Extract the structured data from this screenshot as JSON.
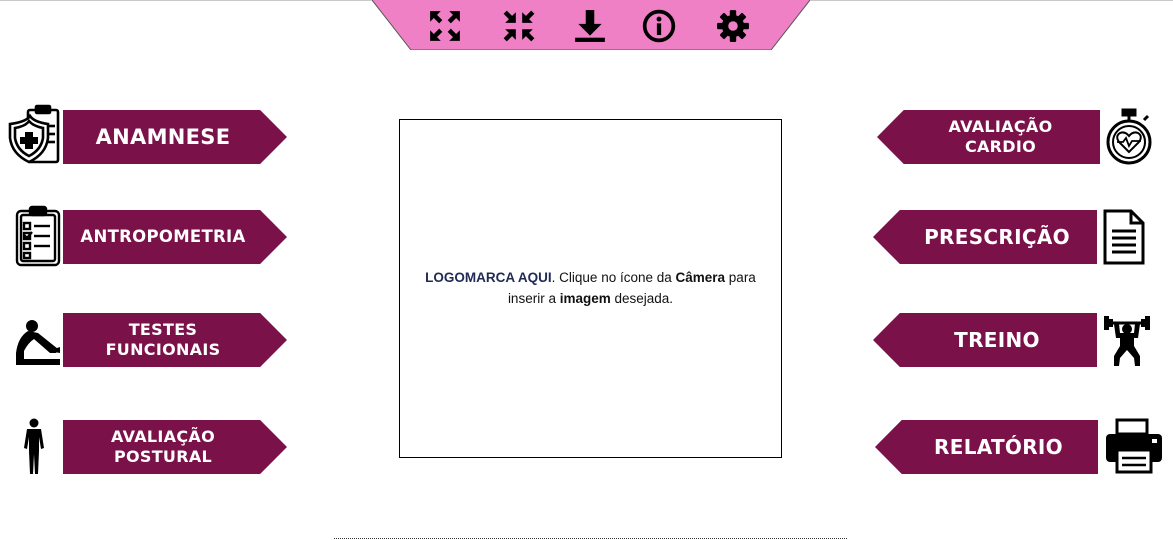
{
  "toolbar": {
    "color": "#ef80c6",
    "buttons": [
      {
        "name": "expand-icon"
      },
      {
        "name": "compress-icon"
      },
      {
        "name": "download-icon"
      },
      {
        "name": "info-icon"
      },
      {
        "name": "gear-icon"
      }
    ]
  },
  "nav_color": "#7b1149",
  "left_menu": {
    "anamnese": "ANAMNESE",
    "antropometria": "ANTROPOMETRIA",
    "testes_funcionais": "TESTES\nFUNCIONAIS",
    "avaliacao_postural": "AVALIAÇÃO\nPOSTURAL"
  },
  "right_menu": {
    "avaliacao_cardio": "AVALIAÇÃO\nCARDIO",
    "prescricao": "PRESCRIÇÃO",
    "treino": "TREINO",
    "relatorio": "RELATÓRIO"
  },
  "logo_box": {
    "highlight": "LOGOMARCA AQUI",
    "text1": ". Clique no ícone da ",
    "bold1": "Câmera",
    "text2": " para inserir a ",
    "bold2": "imagem",
    "text3": " desejada."
  }
}
